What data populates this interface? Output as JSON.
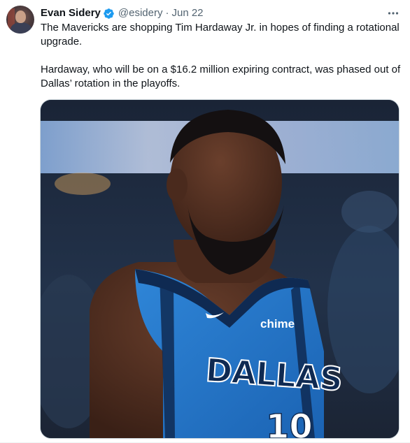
{
  "tweet": {
    "author_name": "Evan Sidery",
    "author_handle": "@esidery",
    "separator": "·",
    "date": "Jun 22",
    "paragraphs": [
      "The Mavericks are shopping Tim Hardaway Jr. in hopes of finding a rotational upgrade.",
      "Hardaway, who will be on a $16.2 million expiring contract, was phased out of Dallas’ rotation in the playoffs."
    ]
  },
  "image": {
    "jersey_text": "DALLAS",
    "jersey_number": "10",
    "sponsor": "chime"
  },
  "colors": {
    "verified_blue": "#1d9bf0",
    "jersey_blue": "#1f6fc4",
    "jersey_navy": "#0f2a52"
  },
  "icons": {
    "verified": "verified-badge-icon",
    "more": "more-options-icon",
    "swoosh": "swoosh-logo"
  }
}
